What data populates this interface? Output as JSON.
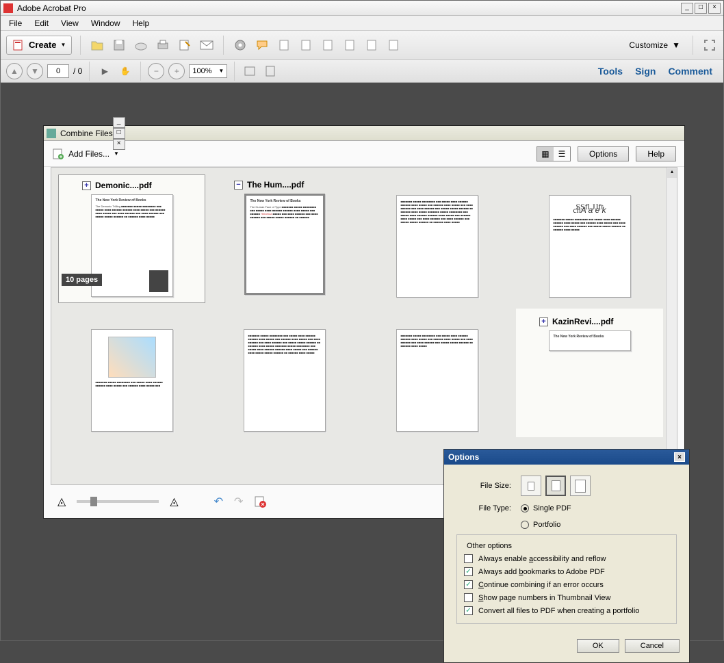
{
  "app": {
    "title": "Adobe Acrobat Pro"
  },
  "menubar": {
    "items": [
      "File",
      "Edit",
      "View",
      "Window",
      "Help"
    ]
  },
  "toolbar1": {
    "create": "Create",
    "customize": "Customize"
  },
  "toolbar2": {
    "page": "0",
    "page_sep": "/ 0",
    "zoom": "100%",
    "links": [
      "Tools",
      "Sign",
      "Comment"
    ]
  },
  "combine": {
    "title": "Combine Files",
    "add_files": "Add Files...",
    "options_btn": "Options",
    "help_btn": "Help",
    "files": [
      {
        "label": "Demonic....pdf",
        "expand": "+",
        "pages": "10 pages",
        "selected": true
      },
      {
        "label": "The Hum....pdf",
        "expand": "−",
        "active": true
      },
      {
        "label": ""
      },
      {
        "label": ""
      },
      {
        "label": ""
      },
      {
        "label": ""
      },
      {
        "label": ""
      },
      {
        "label": "KazinRevi....pdf",
        "expand": "+"
      }
    ]
  },
  "options": {
    "title": "Options",
    "file_size": "File Size:",
    "file_type": "File Type:",
    "single_pdf": "Single PDF",
    "portfolio": "Portfolio",
    "other": "Other options",
    "chk1": "Always enable accessibility and reflow",
    "chk2": "Always add bookmarks to Adobe PDF",
    "chk3": "Continue combining if an error occurs",
    "chk4": "Show page numbers in Thumbnail View",
    "chk5": "Convert all files to PDF when creating a portfolio",
    "ok": "OK",
    "cancel": "Cancel"
  }
}
